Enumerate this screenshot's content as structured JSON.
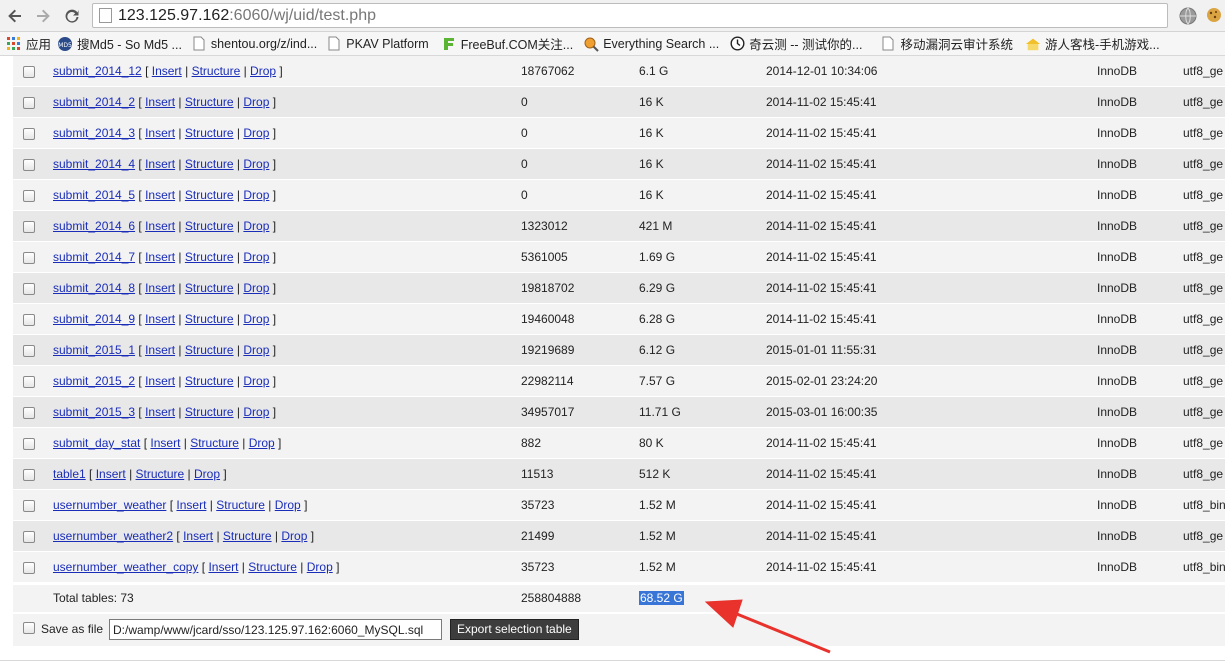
{
  "browser": {
    "url_host": "123.125.97.162",
    "url_rest": ":6060/wj/uid/test.php",
    "bookmarks": [
      {
        "label": "应用",
        "icon": "apps-grid-icon"
      },
      {
        "label": "搜Md5 - So Md5 ...",
        "icon": "somd5-icon"
      },
      {
        "label": "shentou.org/z/ind...",
        "icon": "page-icon"
      },
      {
        "label": "PKAV Platform",
        "icon": "page-icon"
      },
      {
        "label": "FreeBuf.COM关注...",
        "icon": "freebuf-icon"
      },
      {
        "label": "Everything Search ...",
        "icon": "search-app-icon"
      },
      {
        "label": "奇云测 -- 测试你的...",
        "icon": "clock-icon"
      },
      {
        "label": "移动漏洞云审计系统",
        "icon": "page-icon"
      },
      {
        "label": "游人客栈-手机游戏...",
        "icon": "inn-icon"
      }
    ]
  },
  "table": {
    "link_insert": "Insert",
    "link_structure": "Structure",
    "link_drop": "Drop",
    "rows": [
      {
        "name": "submit_2014_12",
        "rows": "18767062",
        "size": "6.1 G",
        "date": "2014-12-01 10:34:06",
        "engine": "InnoDB",
        "collation": "utf8_ge"
      },
      {
        "name": "submit_2014_2",
        "rows": "0",
        "size": "16 K",
        "date": "2014-11-02 15:45:41",
        "engine": "InnoDB",
        "collation": "utf8_ge"
      },
      {
        "name": "submit_2014_3",
        "rows": "0",
        "size": "16 K",
        "date": "2014-11-02 15:45:41",
        "engine": "InnoDB",
        "collation": "utf8_ge"
      },
      {
        "name": "submit_2014_4",
        "rows": "0",
        "size": "16 K",
        "date": "2014-11-02 15:45:41",
        "engine": "InnoDB",
        "collation": "utf8_ge"
      },
      {
        "name": "submit_2014_5",
        "rows": "0",
        "size": "16 K",
        "date": "2014-11-02 15:45:41",
        "engine": "InnoDB",
        "collation": "utf8_ge"
      },
      {
        "name": "submit_2014_6",
        "rows": "1323012",
        "size": "421 M",
        "date": "2014-11-02 15:45:41",
        "engine": "InnoDB",
        "collation": "utf8_ge"
      },
      {
        "name": "submit_2014_7",
        "rows": "5361005",
        "size": "1.69 G",
        "date": "2014-11-02 15:45:41",
        "engine": "InnoDB",
        "collation": "utf8_ge"
      },
      {
        "name": "submit_2014_8",
        "rows": "19818702",
        "size": "6.29 G",
        "date": "2014-11-02 15:45:41",
        "engine": "InnoDB",
        "collation": "utf8_ge"
      },
      {
        "name": "submit_2014_9",
        "rows": "19460048",
        "size": "6.28 G",
        "date": "2014-11-02 15:45:41",
        "engine": "InnoDB",
        "collation": "utf8_ge"
      },
      {
        "name": "submit_2015_1",
        "rows": "19219689",
        "size": "6.12 G",
        "date": "2015-01-01 11:55:31",
        "engine": "InnoDB",
        "collation": "utf8_ge"
      },
      {
        "name": "submit_2015_2",
        "rows": "22982114",
        "size": "7.57 G",
        "date": "2015-02-01 23:24:20",
        "engine": "InnoDB",
        "collation": "utf8_ge"
      },
      {
        "name": "submit_2015_3",
        "rows": "34957017",
        "size": "11.71 G",
        "date": "2015-03-01 16:00:35",
        "engine": "InnoDB",
        "collation": "utf8_ge"
      },
      {
        "name": "submit_day_stat",
        "rows": "882",
        "size": "80 K",
        "date": "2014-11-02 15:45:41",
        "engine": "InnoDB",
        "collation": "utf8_ge"
      },
      {
        "name": "table1",
        "rows": "11513",
        "size": "512 K",
        "date": "2014-11-02 15:45:41",
        "engine": "InnoDB",
        "collation": "utf8_ge"
      },
      {
        "name": "usernumber_weather",
        "rows": "35723",
        "size": "1.52 M",
        "date": "2014-11-02 15:45:41",
        "engine": "InnoDB",
        "collation": "utf8_bin"
      },
      {
        "name": "usernumber_weather2",
        "rows": "21499",
        "size": "1.52 M",
        "date": "2014-11-02 15:45:41",
        "engine": "InnoDB",
        "collation": "utf8_ge"
      },
      {
        "name": "usernumber_weather_copy",
        "rows": "35723",
        "size": "1.52 M",
        "date": "2014-11-02 15:45:41",
        "engine": "InnoDB",
        "collation": "utf8_bin"
      }
    ],
    "total": {
      "label": "Total tables: 73",
      "rows": "258804888",
      "size": "68.52 G"
    }
  },
  "save": {
    "label": "Save as file",
    "path_value": "D:/wamp/www/jcard/sso/123.125.97.162:6060_MySQL.sql",
    "export_label": "Export selection table"
  },
  "annotation": {
    "color": "#e8322b"
  }
}
